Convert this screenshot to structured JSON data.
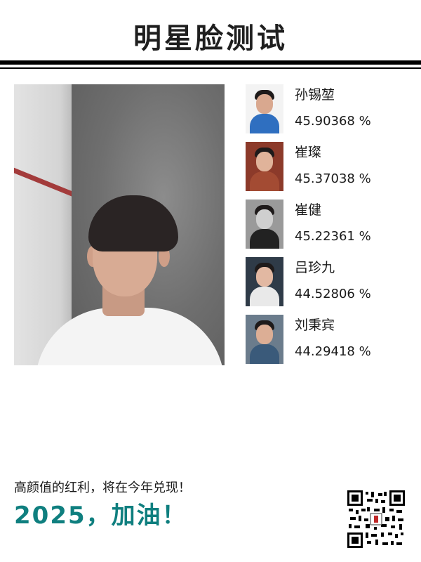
{
  "title": "明星脸测试",
  "results": [
    {
      "name": "孙锡堃",
      "score": "45.90368 %"
    },
    {
      "name": "崔璨",
      "score": "45.37038 %"
    },
    {
      "name": "崔健",
      "score": "45.22361 %"
    },
    {
      "name": "吕珍九",
      "score": "44.52806 %"
    },
    {
      "name": "刘秉宾",
      "score": "44.29418 %"
    }
  ],
  "footer": {
    "slogan": "高颜值的红利，将在今年兑现！",
    "cheer": "2025，加油！"
  },
  "colors": {
    "accent": "#0f7f7f",
    "rule": "#000000"
  }
}
